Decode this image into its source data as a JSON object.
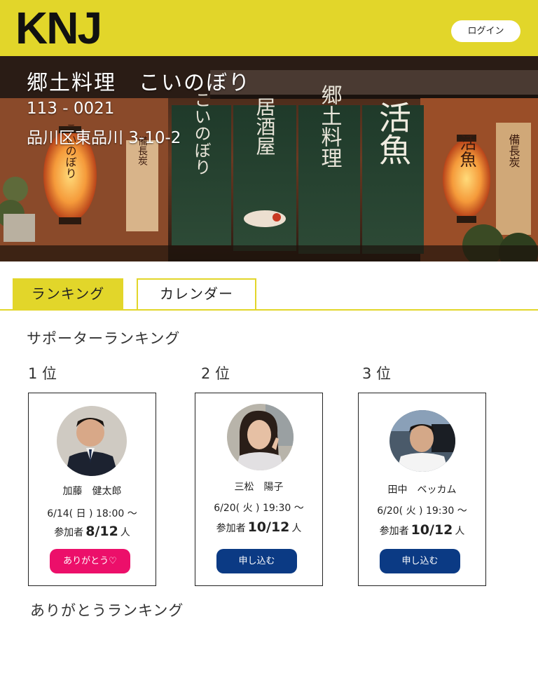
{
  "header": {
    "logo": "KNJ",
    "login_label": "ログイン"
  },
  "restaurant": {
    "name": "郷土料理　こいのぼり",
    "zip": "113 - 0021",
    "address": "品川区東品川 3-10-2"
  },
  "tabs": [
    {
      "label": "ランキング",
      "active": true
    },
    {
      "label": "カレンダー",
      "active": false
    }
  ],
  "supporter_ranking": {
    "title": "サポーターランキング",
    "entries": [
      {
        "rank_label": "1 位",
        "name": "加藤　健太郎",
        "date": "6/14( 日 ) 18:00 ～",
        "participants_prefix": "参加者",
        "participants": "8/12",
        "participants_suffix": "人",
        "button_label": "ありがとう♡",
        "button_color": "#ec0f6a"
      },
      {
        "rank_label": "2 位",
        "name": "三松　陽子",
        "date": "6/20( 火 ) 19:30 ～",
        "participants_prefix": "参加者",
        "participants": "10/12",
        "participants_suffix": "人",
        "button_label": "申し込む",
        "button_color": "#0b3a84"
      },
      {
        "rank_label": "3 位",
        "name": "田中　ベッカム",
        "date": "6/20( 火 ) 19:30 ～",
        "participants_prefix": "参加者",
        "participants": "10/12",
        "participants_suffix": "人",
        "button_label": "申し込む",
        "button_color": "#0b3a84"
      }
    ]
  },
  "thanks_ranking": {
    "title": "ありがとうランキング"
  },
  "hero_banners": {
    "lantern_left": "こいのぼり",
    "curtain_1": "こいのぼり",
    "curtain_2": "居酒屋",
    "curtain_3": "郷土料理",
    "curtain_4": "活魚",
    "lantern_right": "活魚",
    "sign_left": "備長炭",
    "sign_right": "備長炭"
  },
  "colors": {
    "accent": "#e2d62a",
    "thanks_button": "#ec0f6a",
    "apply_button": "#0b3a84"
  }
}
